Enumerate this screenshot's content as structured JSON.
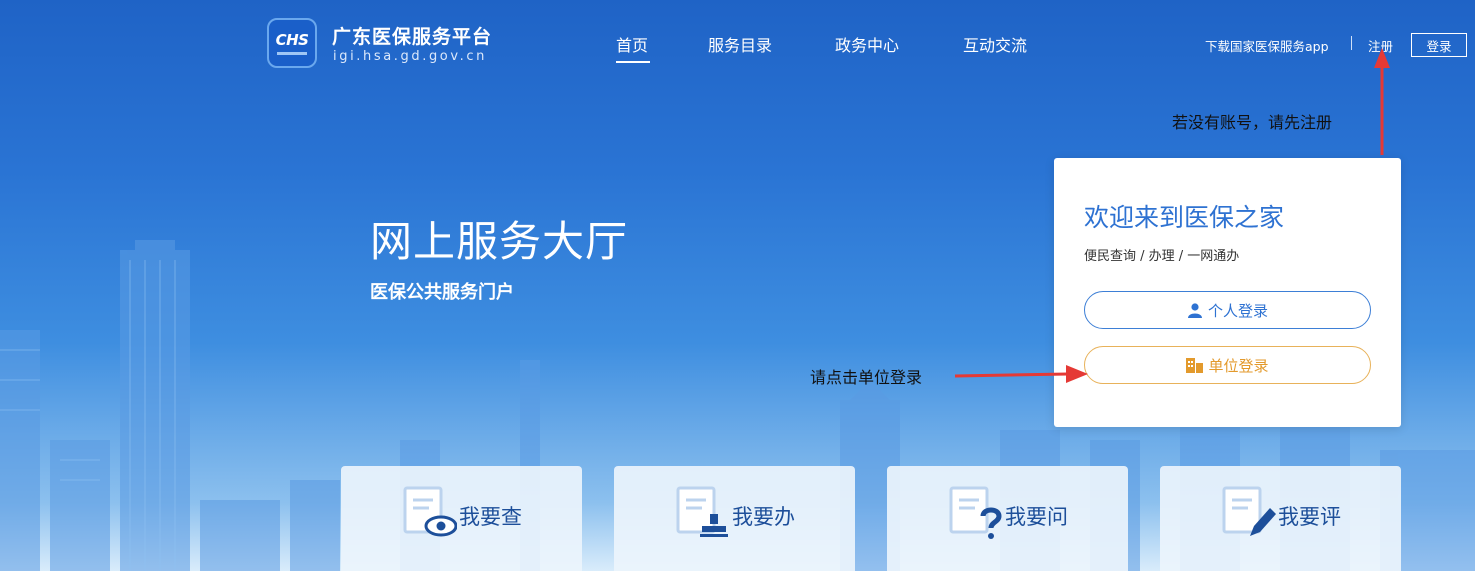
{
  "header": {
    "logo_text": "CHS",
    "site_title": "广东医保服务平台",
    "site_domain": "igi.hsa.gd.gov.cn",
    "nav": [
      {
        "label": "首页",
        "active": true
      },
      {
        "label": "服务目录",
        "active": false
      },
      {
        "label": "政务中心",
        "active": false
      },
      {
        "label": "互动交流",
        "active": false
      }
    ],
    "download_app": "下载国家医保服务app",
    "register": "注册",
    "login": "登录"
  },
  "hero": {
    "title": "网上服务大厅",
    "subtitle": "医保公共服务门户"
  },
  "annotations": {
    "register_note": "若没有账号，请先注册",
    "unit_note": "请点击单位登录"
  },
  "login_card": {
    "title": "欢迎来到医保之家",
    "subtitle": "便民查询 / 办理 / 一网通办",
    "personal_login": "个人登录",
    "unit_login": "单位登录"
  },
  "tiles": [
    {
      "label": "我要查",
      "icon": "eye-document-icon"
    },
    {
      "label": "我要办",
      "icon": "stamp-document-icon"
    },
    {
      "label": "我要问",
      "icon": "question-document-icon"
    },
    {
      "label": "我要评",
      "icon": "pen-document-icon"
    }
  ],
  "colors": {
    "primary": "#2e72d2",
    "unit_accent": "#e39a2c",
    "annotation_arrow": "#e53935"
  }
}
